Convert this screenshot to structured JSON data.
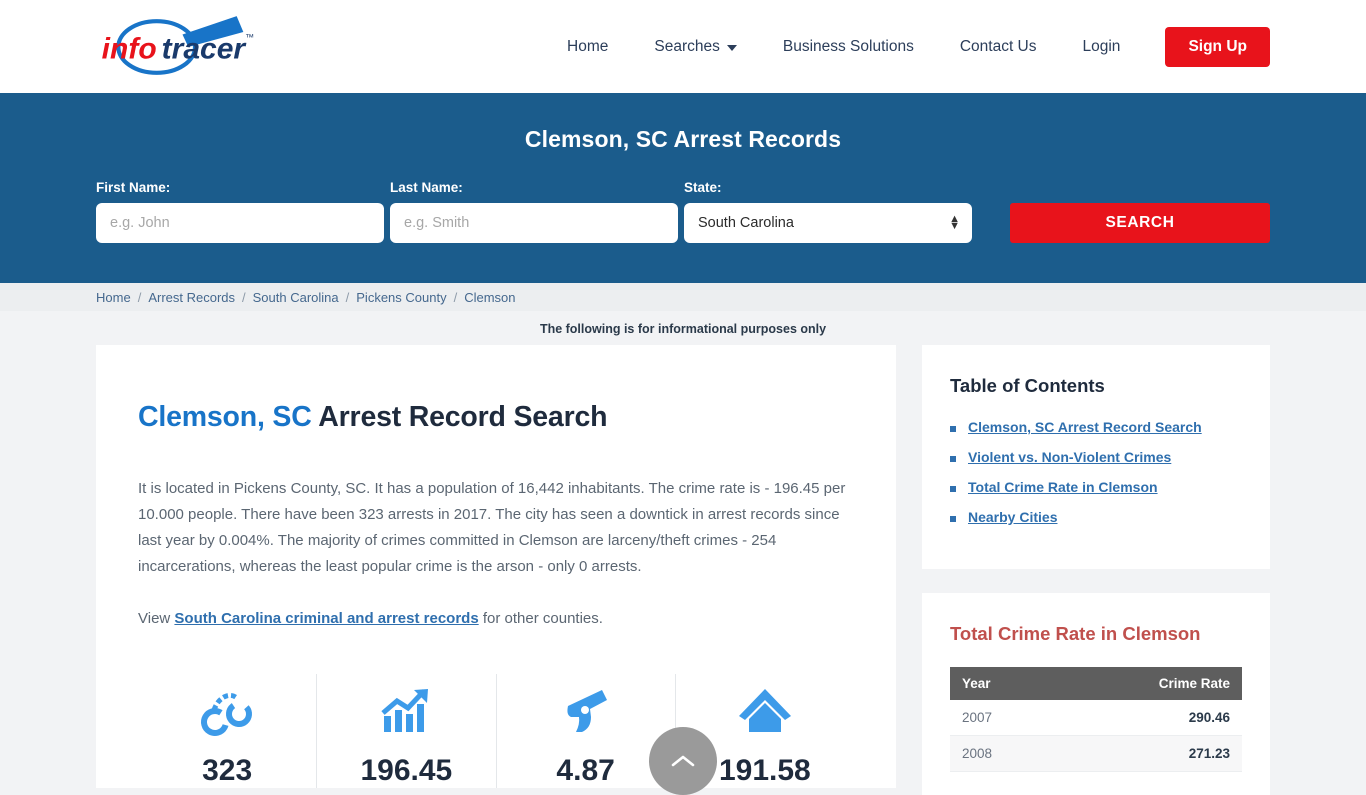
{
  "header": {
    "logo_alt": "infotracer",
    "nav": [
      {
        "label": "Home",
        "has_dropdown": false
      },
      {
        "label": "Searches",
        "has_dropdown": true
      },
      {
        "label": "Business Solutions",
        "has_dropdown": false
      },
      {
        "label": "Contact Us",
        "has_dropdown": false
      },
      {
        "label": "Login",
        "has_dropdown": false
      }
    ],
    "signup_label": "Sign Up"
  },
  "search_band": {
    "title": "Clemson, SC Arrest Records",
    "first_name_label": "First Name:",
    "first_name_placeholder": "e.g. John",
    "first_name_value": "",
    "last_name_label": "Last Name:",
    "last_name_placeholder": "e.g. Smith",
    "last_name_value": "",
    "state_label": "State:",
    "state_value": "South Carolina",
    "state_options": [
      "South Carolina"
    ],
    "search_button": "SEARCH"
  },
  "breadcrumb": {
    "items": [
      "Home",
      "Arrest Records",
      "South Carolina",
      "Pickens County",
      "Clemson"
    ],
    "separator": "/"
  },
  "info_note": "The following is for informational purposes only",
  "main": {
    "title_city": "Clemson,",
    "title_state": "SC",
    "title_rest": "Arrest Record Search",
    "paragraph": "It is located in Pickens County, SC. It has a population of 16,442 inhabitants. The crime rate is - 196.45 per 10.000 people. There have been 323 arrests in 2017. The city has seen a downtick in arrest records since last year by 0.004%. The majority of crimes committed in Clemson are larceny/theft crimes - 254 incarcerations, whereas the least popular crime is the arson - only 0 arrests.",
    "view_prefix": "View ",
    "view_link": "South Carolina criminal and arrest records",
    "view_suffix": " for other counties.",
    "stats": [
      {
        "icon": "handcuffs-icon",
        "value": "323"
      },
      {
        "icon": "trending-up-chart-icon",
        "value": "196.45"
      },
      {
        "icon": "handgun-icon",
        "value": "4.87"
      },
      {
        "icon": "house-icon",
        "value": "191.58"
      }
    ]
  },
  "sidebar": {
    "toc_title": "Table of Contents",
    "toc_items": [
      "Clemson, SC Arrest Record Search",
      "Violent vs. Non-Violent Crimes",
      "Total Crime Rate in Clemson",
      "Nearby Cities"
    ],
    "rate_title": "Total Crime Rate in Clemson",
    "rate_columns": [
      "Year",
      "Crime Rate"
    ],
    "rate_rows": [
      {
        "year": "2007",
        "rate": "290.46"
      },
      {
        "year": "2008",
        "rate": "271.23"
      }
    ]
  },
  "scroll_top": {
    "icon": "chevron-up-icon",
    "label": ""
  },
  "colors": {
    "brand_blue": "#1b5c8c",
    "brand_red": "#e8131b",
    "link_blue": "#2f6fae",
    "stat_icon_blue": "#3d9be9",
    "table_header_gray": "#5e5e5e",
    "rate_title_red": "#c0504d",
    "page_bg": "#f2f3f5"
  }
}
